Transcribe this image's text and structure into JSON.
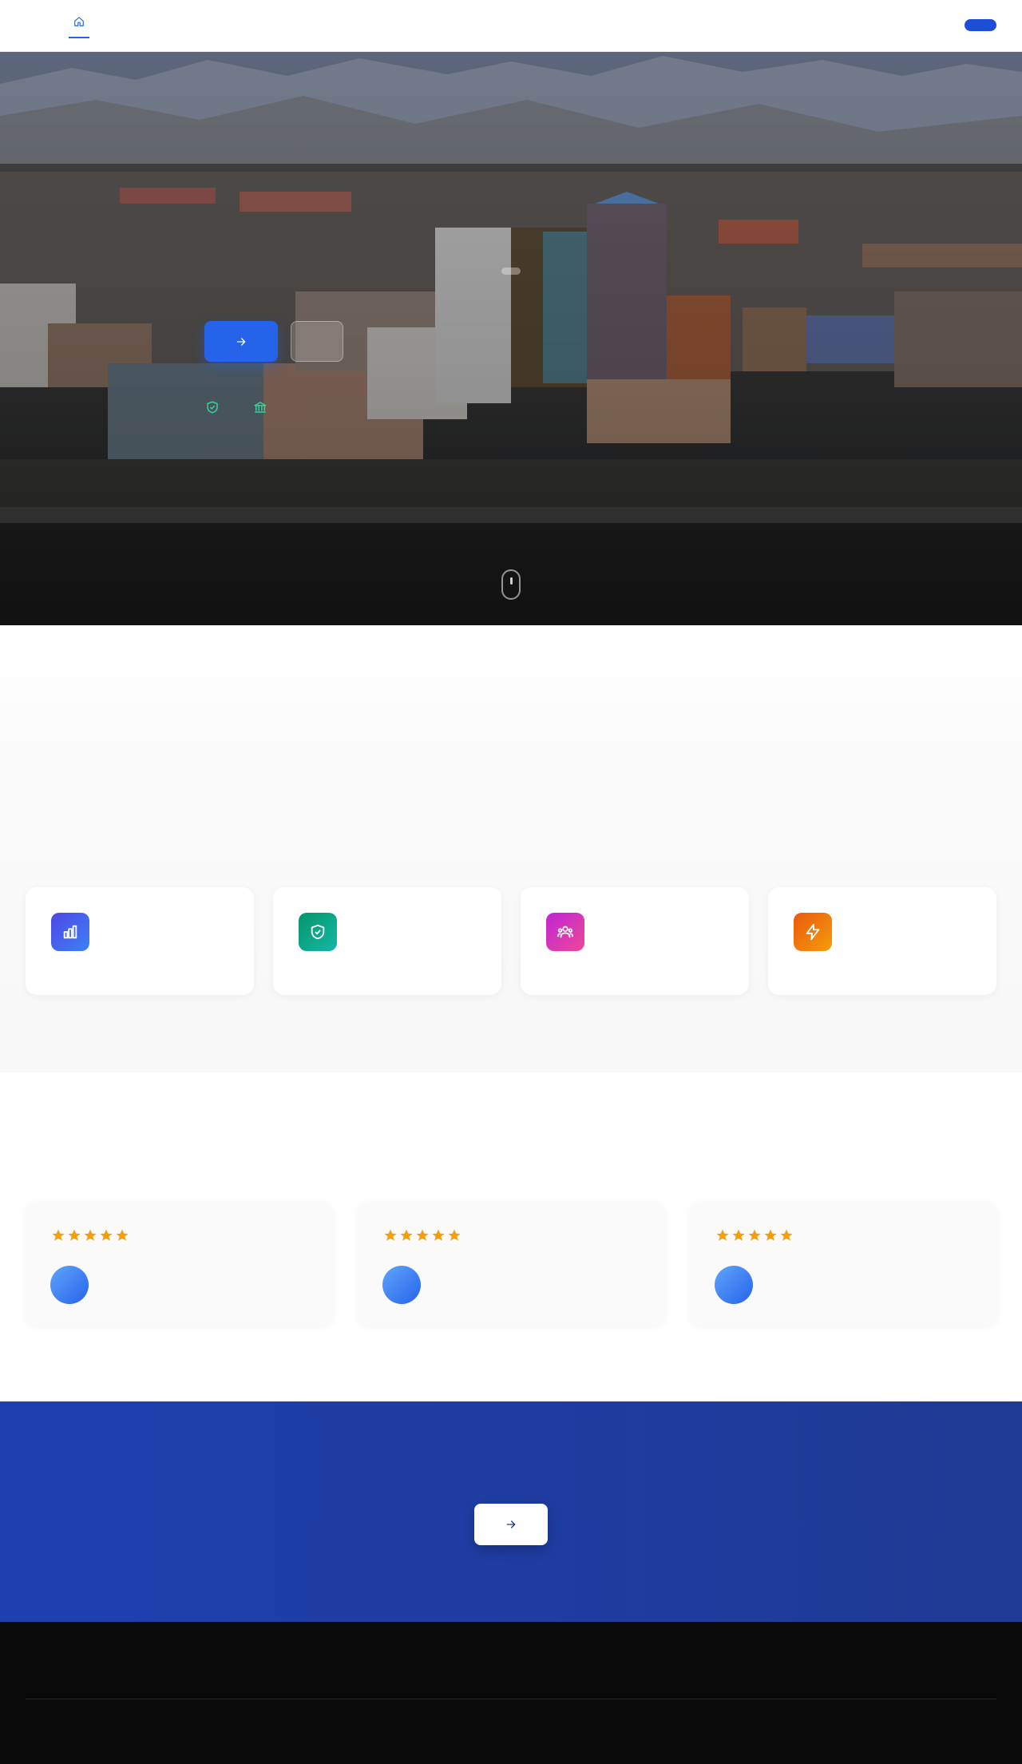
{
  "header": {
    "home_icon": "home-icon",
    "accent": "#2563eb",
    "cta_color": "#1d4ed8"
  },
  "hero": {
    "primary_icon": "arrow-right-icon",
    "trust_icons": [
      "shield-check-icon",
      "bank-icon"
    ],
    "scroll_icon": "mouse-scroll-icon",
    "primary_color": "#2563eb"
  },
  "features": {
    "cards": [
      {
        "icon": "bar-chart-icon",
        "color_from": "#4f46e5",
        "color_to": "#3b82f6",
        "title": ""
      },
      {
        "icon": "shield-check-icon",
        "color_from": "#059669",
        "color_to": "#14b8a6",
        "title": ""
      },
      {
        "icon": "users-icon",
        "color_from": "#c026d3",
        "color_to": "#ec4899",
        "title": ""
      },
      {
        "icon": "lightning-icon",
        "color_from": "#ea580c",
        "color_to": "#f59e0b",
        "title": ""
      }
    ]
  },
  "testimonials": {
    "cards": [
      {
        "rating": 5,
        "avatar": "avatar"
      },
      {
        "rating": 5,
        "avatar": "avatar"
      },
      {
        "rating": 5,
        "avatar": "avatar"
      }
    ],
    "star_color": "#f59e0b"
  },
  "cta": {
    "button_icon": "arrow-right-icon",
    "background": "#1e40af"
  },
  "footer": {
    "background": "#0a0a0a"
  }
}
